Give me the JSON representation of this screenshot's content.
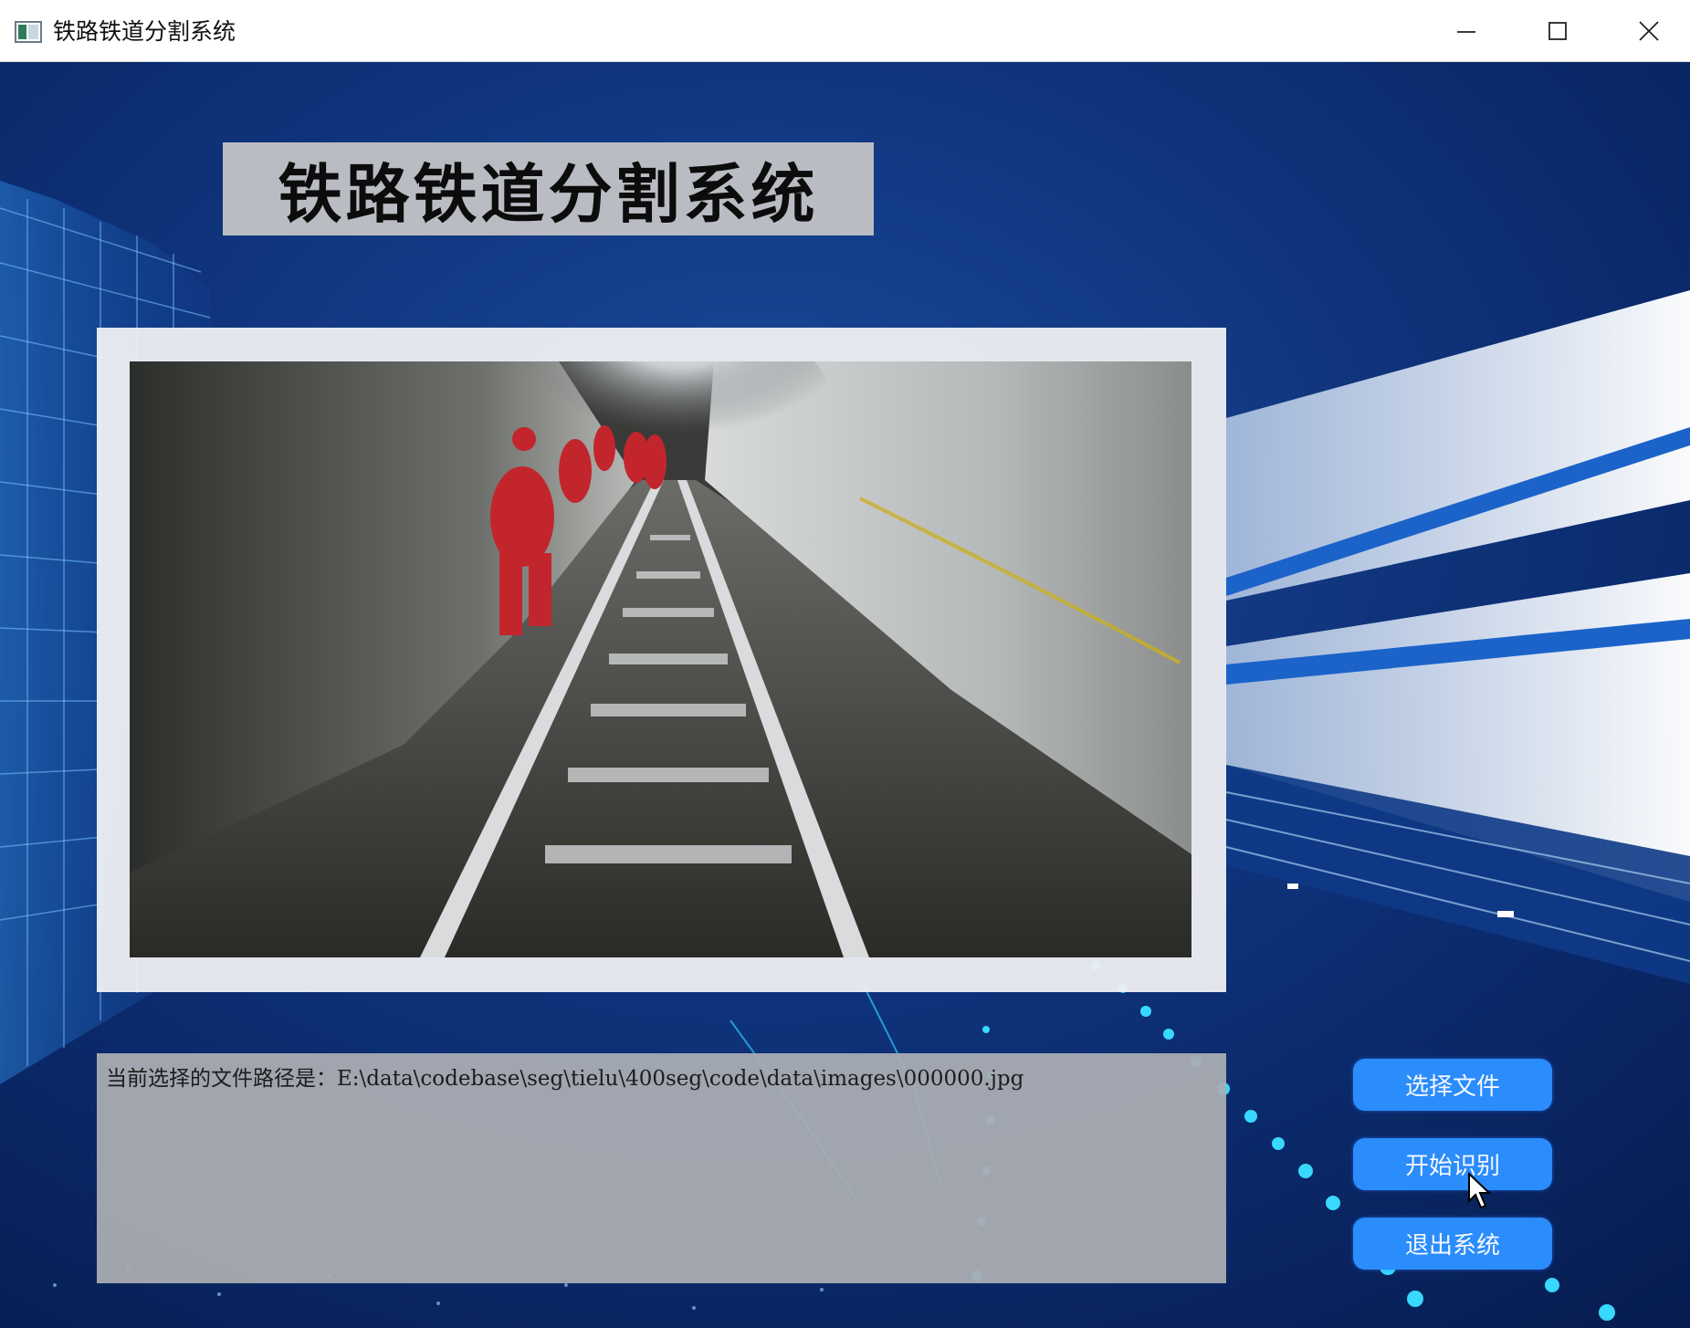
{
  "window": {
    "title": "铁路铁道分割系统",
    "icon": "app-window-icon",
    "controls": [
      "minimize-icon",
      "maximize-icon",
      "close-icon"
    ]
  },
  "header": {
    "title": "铁路铁道分割系统"
  },
  "image_view": {
    "content": "railway-tunnel-photo"
  },
  "path_box": {
    "text": "当前选择的文件路径是：E:\\data\\codebase\\seg\\tielu\\400seg\\code\\data\\images\\000000.jpg"
  },
  "buttons": {
    "select_file": "选择文件",
    "start_recognition": "开始识别",
    "exit_system": "退出系统"
  },
  "colors": {
    "background": "#0b2a6b",
    "button": "#2b8cfb",
    "header_box": "#b9bcc2",
    "panel": "#eceef1",
    "text_area": "#aaadb2"
  }
}
